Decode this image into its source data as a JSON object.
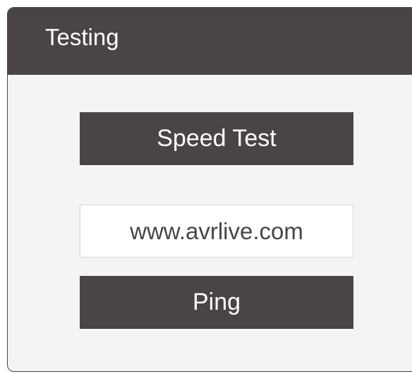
{
  "panel": {
    "title": "Testing"
  },
  "actions": {
    "speed_test_label": "Speed Test",
    "ping_label": "Ping"
  },
  "host_field": {
    "value": "www.avrlive.com"
  },
  "colors": {
    "header_bg": "#4a4444",
    "button_bg": "#4a4444",
    "panel_bg": "#f4f4f4"
  }
}
